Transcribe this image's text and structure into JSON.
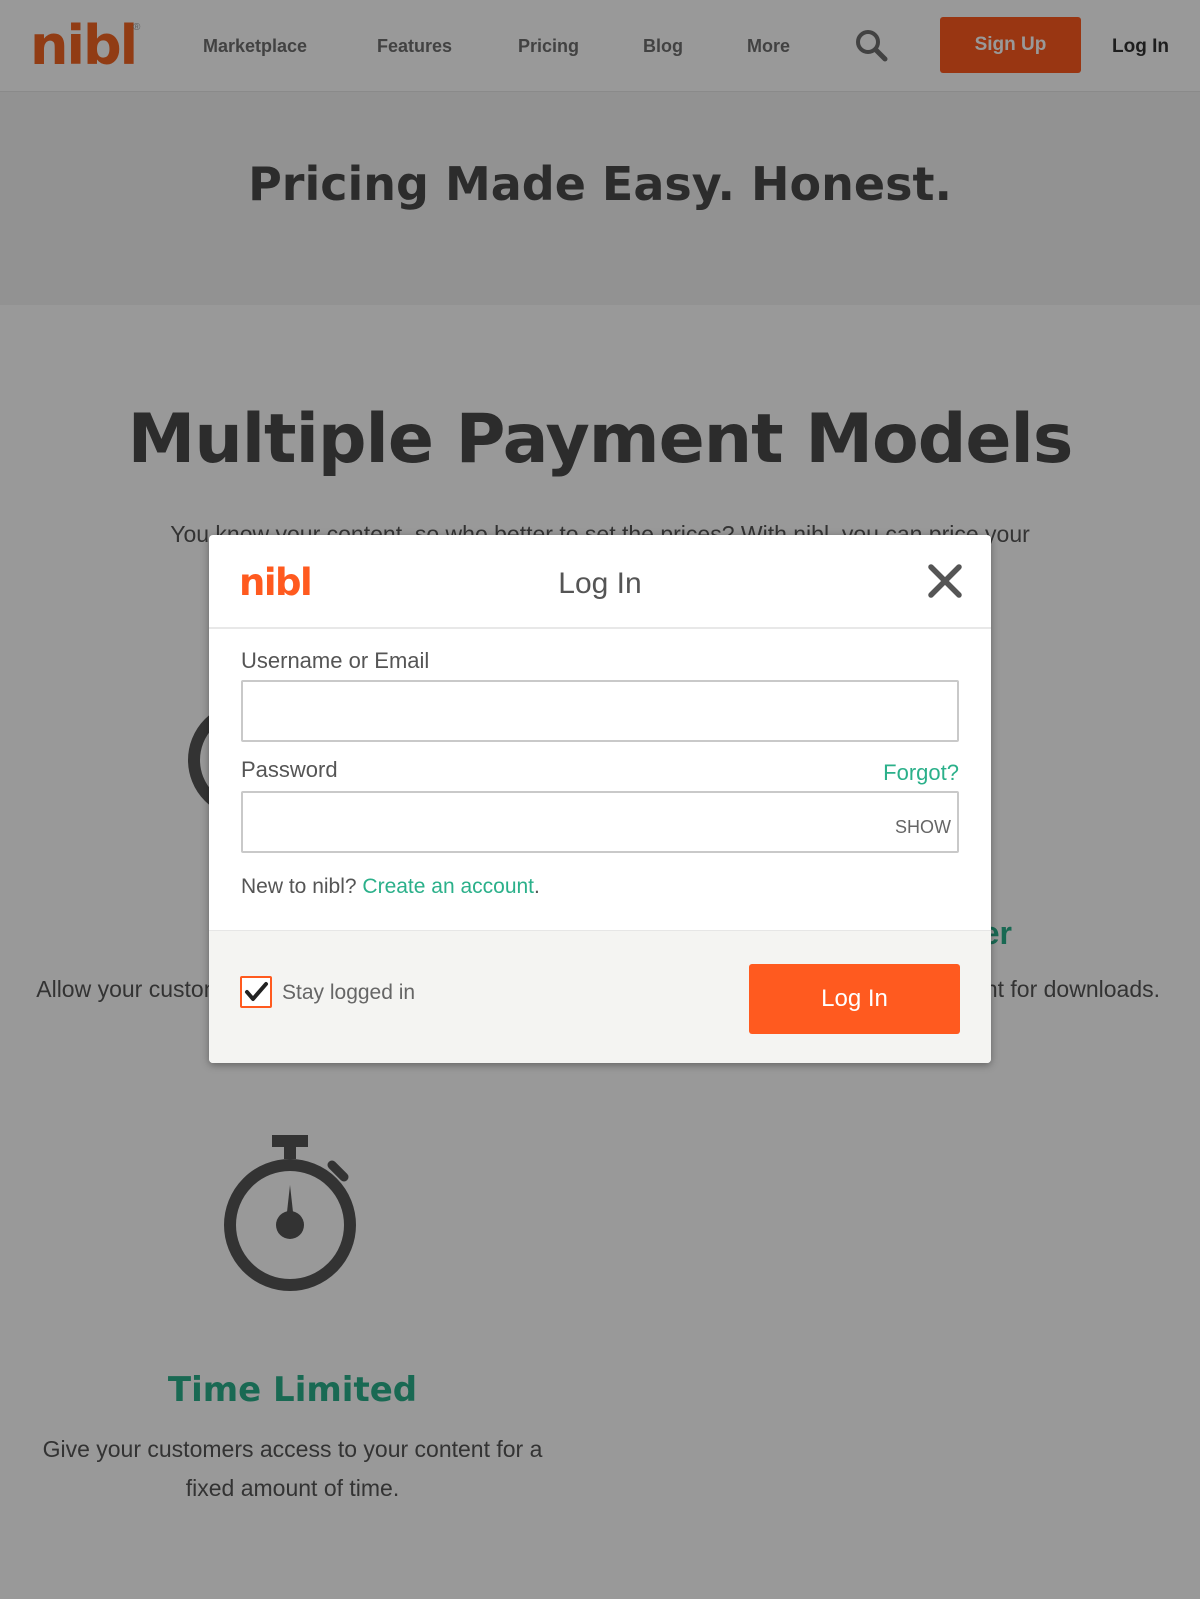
{
  "nav": {
    "logo": "nibl",
    "logo_mark": "®",
    "links": [
      "Marketplace",
      "Features",
      "Pricing",
      "Blog",
      "More"
    ],
    "search_icon": "search-icon",
    "signup_label": "Sign Up",
    "login_label": "Log In"
  },
  "hero": {
    "title": "Pricing Made Easy. Honest."
  },
  "section": {
    "title": "Multiple Payment Models",
    "desc": "You know your content, so who better to set the prices? With nibl, you can price your content with our multiple payment models."
  },
  "features": {
    "left_desc": "Allow your customers to access your content for a limited time.",
    "right_title": "er",
    "right_desc": "your content for downloads.",
    "time_title": "Time Limited",
    "time_desc": "Give your customers access to your content for a fixed amount of time."
  },
  "modal": {
    "logo": "nibl",
    "title": "Log In",
    "close_icon": "close-icon",
    "username_label": "Username or Email",
    "username_value": "",
    "password_label": "Password",
    "password_value": "",
    "forgot_label": "Forgot?",
    "show_label": "SHOW",
    "new_prefix": "New to nibl? ",
    "create_label": "Create an account",
    "new_suffix": ".",
    "stay_label": "Stay logged in",
    "stay_checked": true,
    "login_button": "Log In"
  },
  "colors": {
    "brand": "#ff5a1f",
    "accent": "#2bb08a",
    "overlay": "rgba(0,0,0,0.40)"
  }
}
